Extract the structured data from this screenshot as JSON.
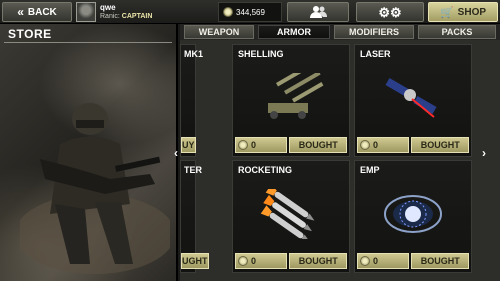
{
  "topbar": {
    "back_label": "BACK",
    "player_name": "qwe",
    "rank_prefix": "Ranic:",
    "rank": "CAPTAIN",
    "money": "344,569",
    "shop_label": "SHOP"
  },
  "store": {
    "title": "STORE"
  },
  "tabs": [
    {
      "label": "WEAPON",
      "active": false
    },
    {
      "label": "ARMOR",
      "active": true
    },
    {
      "label": "MODIFIERS",
      "active": false
    },
    {
      "label": "PACKS",
      "active": false
    }
  ],
  "items": [
    {
      "label": "MK1",
      "buy_label": "UY"
    },
    {
      "label": "SHELLING",
      "price": "0",
      "buy_label": "BOUGHT"
    },
    {
      "label": "LASER",
      "price": "0",
      "buy_label": "BOUGHT"
    },
    {
      "label": "TER",
      "buy_label": "UGHT"
    },
    {
      "label": "ROCKETING",
      "price": "0",
      "buy_label": "BOUGHT"
    },
    {
      "label": "EMP",
      "price": "0",
      "buy_label": "BOUGHT"
    }
  ],
  "nav": {
    "left": "‹",
    "right": "›"
  },
  "colors": {
    "gold": "#cfc991",
    "dark": "#1b1b19"
  }
}
